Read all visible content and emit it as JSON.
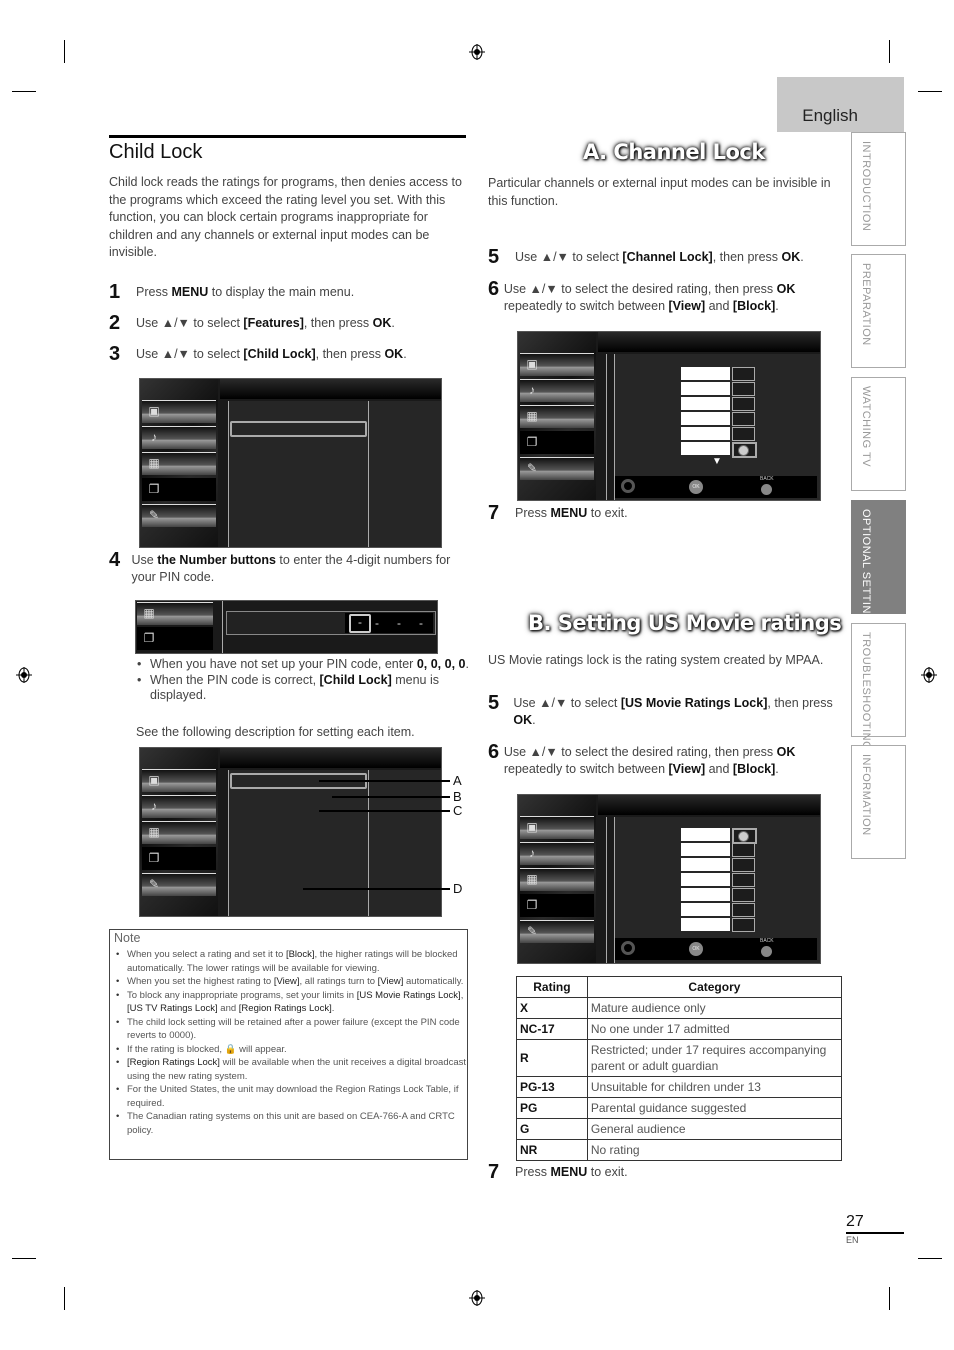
{
  "page": {
    "language_label": "English",
    "page_number": "27",
    "page_lang_code": "EN"
  },
  "section_tabs": [
    {
      "label": "INTRODUCTION",
      "active": false
    },
    {
      "label": "PREPARATION",
      "active": false
    },
    {
      "label": "WATCHING TV",
      "active": false
    },
    {
      "label": "OPTIONAL SETTING",
      "active": true
    },
    {
      "label": "TROUBLESHOOTING",
      "active": false
    },
    {
      "label": "INFORMATION",
      "active": false
    }
  ],
  "child_lock": {
    "title": "Child Lock",
    "intro": "Child lock reads the ratings for programs, then denies access to the programs which exceed the rating level you set. With this function, you can block certain programs inappropriate for children and any channels or external input modes can be invisible.",
    "steps": [
      {
        "num": "1",
        "pre": "Press ",
        "b1": "MENU",
        "mid": " to display the main menu.",
        "b2": "",
        "post": ""
      },
      {
        "num": "2",
        "pre": "Use ▲/▼ to select ",
        "b1": "[Features]",
        "mid": ", then press ",
        "b2": "OK",
        "post": "."
      },
      {
        "num": "3",
        "pre": "Use ▲/▼ to select ",
        "b1": "[Child Lock]",
        "mid": ", then press ",
        "b2": "OK",
        "post": "."
      },
      {
        "num": "4",
        "pre": "Use ",
        "b1": "the Number buttons",
        "mid": " to enter the 4-digit numbers for your PIN code.",
        "b2": "",
        "post": ""
      }
    ],
    "pin_display": [
      "-",
      "-",
      "-",
      "-"
    ],
    "bullets": [
      {
        "pre": "When you have not set up your PIN code, enter ",
        "b": "0, 0, 0, 0",
        "post": "."
      },
      {
        "pre": "When the PIN code is correct, ",
        "b": "[Child Lock]",
        "post": " menu is displayed."
      }
    ],
    "see_following": "See the following description for setting each item.",
    "callouts": [
      "A",
      "B",
      "C",
      "D"
    ]
  },
  "note": {
    "title": "Note",
    "items": [
      "When you select a rating and set it to <b>[Block]</b>, the higher ratings will be blocked automatically. The lower ratings will be available for viewing.",
      "When you set the highest rating to <b>[View]</b>, all ratings turn to <b>[View]</b> automatically.",
      "To block any inappropriate programs, set your limits in <b>[US Movie Ratings Lock]</b>, <b>[US TV Ratings Lock]</b> and <b>[Region Ratings Lock]</b>.",
      "The child lock setting will be retained after a power failure (except the PIN code reverts to 0000).",
      "If the rating is blocked, 🔒 will appear.",
      "<b>[Region Ratings Lock]</b> will be available when the unit receives a digital broadcast using the new rating system.",
      "For the United States, the unit may download the Region Ratings Lock Table, if required.",
      "The Canadian rating systems on this unit are based on CEA-766-A and CRTC policy."
    ]
  },
  "channel_lock": {
    "heading": "A. Channel Lock",
    "intro": "Particular channels or external input modes can be invisible in this function.",
    "steps": [
      {
        "num": "5",
        "pre": "Use ▲/▼ to select ",
        "b1": "[Channel Lock]",
        "mid": ", then press ",
        "b2": "OK",
        "post": ".",
        "b3": "",
        "post2": ""
      },
      {
        "num": "6",
        "pre": "Use ▲/▼ to select the desired rating, then press ",
        "b1": "OK",
        "mid": " repeatedly to switch between ",
        "b2": "[View]",
        "post": " and ",
        "b3": "[Block]",
        "post2": "."
      },
      {
        "num": "7",
        "pre": "Press ",
        "b1": "MENU",
        "mid": " to exit.",
        "b2": "",
        "post": "",
        "b3": "",
        "post2": ""
      }
    ],
    "rows_locked": [
      false,
      false,
      false,
      false,
      false,
      true
    ]
  },
  "movie_ratings": {
    "heading": "B. Setting US Movie ratings",
    "intro": "US Movie ratings lock is the rating system created by MPAA.",
    "steps": [
      {
        "num": "5",
        "pre": "Use ▲/▼ to select ",
        "b1": "[US Movie Ratings Lock]",
        "mid": ", then press ",
        "b2": "OK",
        "post": ".",
        "b3": "",
        "post2": ""
      },
      {
        "num": "6",
        "pre": "Use ▲/▼ to select the desired rating, then press ",
        "b1": "OK",
        "mid": " repeatedly to switch between ",
        "b2": "[View]",
        "post": " and ",
        "b3": "[Block]",
        "post2": "."
      },
      {
        "num": "7",
        "pre": "Press ",
        "b1": "MENU",
        "mid": " to exit.",
        "b2": "",
        "post": "",
        "b3": "",
        "post2": ""
      }
    ],
    "rows_locked": [
      true,
      false,
      false,
      false,
      false,
      false,
      false
    ],
    "table": {
      "headers": [
        "Rating",
        "Category"
      ],
      "rows": [
        [
          "X",
          "Mature audience only"
        ],
        [
          "NC-17",
          "No one under 17 admitted"
        ],
        [
          "R",
          "Restricted; under 17 requires accompanying parent or adult guardian"
        ],
        [
          "PG-13",
          "Unsuitable for children under 13"
        ],
        [
          "PG",
          "Parental guidance suggested"
        ],
        [
          "G",
          "General audience"
        ],
        [
          "NR",
          "No rating"
        ]
      ]
    }
  },
  "tv_controls": {
    "ok_label": "OK",
    "back_label": "BACK"
  }
}
